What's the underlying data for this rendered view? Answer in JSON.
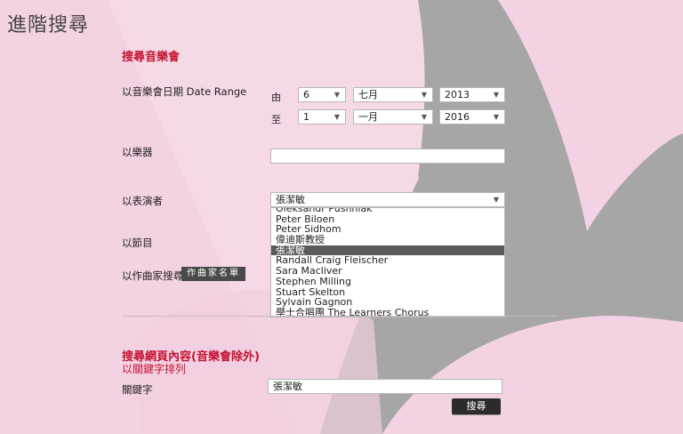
{
  "page": {
    "title": "進階搜尋"
  },
  "concert_search": {
    "heading": "搜尋音樂會",
    "date_range_label": "以音樂會日期 Date Range",
    "from_label": "由",
    "to_label": "至",
    "from": {
      "day": "6",
      "month": "七月",
      "year": "2013"
    },
    "to": {
      "day": "1",
      "month": "一月",
      "year": "2016"
    },
    "instrument_label": "以樂器",
    "instrument_value": "",
    "performer_label": "以表演者",
    "performer_value": "張潔敏",
    "performer_options": [
      "Oleksandr Pushniak",
      "Peter Biloen",
      "Peter Sidhom",
      "偉迪斯教授",
      "張潔敏",
      "Randall Craig Fleischer",
      "Sara Macliver",
      "Stephen Milling",
      "Stuart Skelton",
      "Sylvain Gagnon",
      "學士合唱團 The Learners Chorus"
    ],
    "selected_option_index": 4,
    "program_label": "以節目",
    "composer_label": "以作曲家搜尋",
    "composer_button": "作曲家名單"
  },
  "site_search": {
    "heading": "搜尋網頁內容(音樂會除外)",
    "subheading": "以關鍵字排列",
    "keyword_label": "關鍵字",
    "keyword_value": "張潔敏",
    "search_button": "搜尋"
  },
  "colors": {
    "accent": "#c4122f",
    "background_pink": "#f3d3e3",
    "background_gray": "#a9a9a9"
  }
}
